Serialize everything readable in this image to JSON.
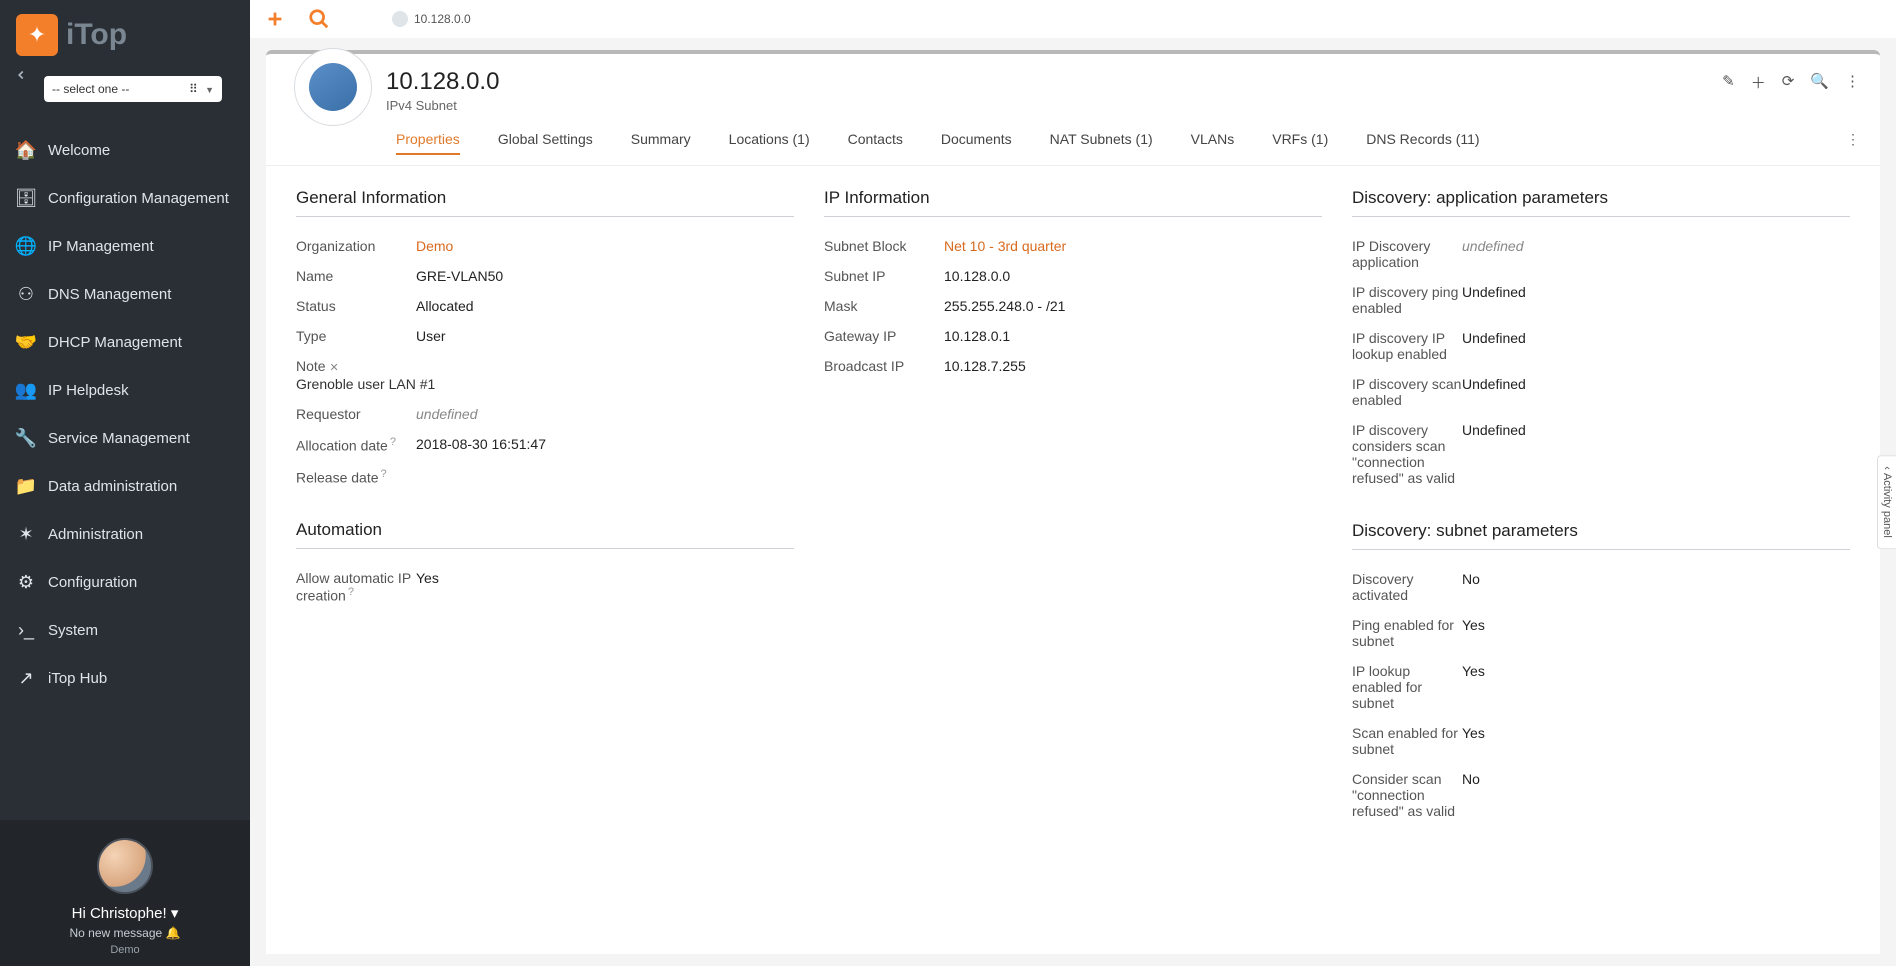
{
  "brand": "iTop",
  "org_select_placeholder": "-- select one --",
  "sidebar": {
    "items": [
      {
        "label": "Welcome"
      },
      {
        "label": "Configuration Management"
      },
      {
        "label": "IP Management"
      },
      {
        "label": "DNS Management"
      },
      {
        "label": "DHCP Management"
      },
      {
        "label": "IP Helpdesk"
      },
      {
        "label": "Service Management"
      },
      {
        "label": "Data administration"
      },
      {
        "label": "Administration"
      },
      {
        "label": "Configuration"
      },
      {
        "label": "System"
      },
      {
        "label": "iTop Hub"
      }
    ]
  },
  "user": {
    "greeting": "Hi Christophe!",
    "message": "No new message",
    "org": "Demo"
  },
  "tab_chip": "10.128.0.0",
  "object": {
    "title": "10.128.0.0",
    "subtitle": "IPv4 Subnet"
  },
  "tabs": [
    "Properties",
    "Global Settings",
    "Summary",
    "Locations (1)",
    "Contacts",
    "Documents",
    "NAT Subnets (1)",
    "VLANs",
    "VRFs (1)",
    "DNS Records (11)"
  ],
  "general": {
    "heading": "General Information",
    "organization_label": "Organization",
    "organization": "Demo",
    "name_label": "Name",
    "name": "GRE-VLAN50",
    "status_label": "Status",
    "status": "Allocated",
    "type_label": "Type",
    "type": "User",
    "note_label": "Note",
    "note": "Grenoble user LAN #1",
    "requestor_label": "Requestor",
    "requestor": "undefined",
    "alloc_label": "Allocation date",
    "alloc": "2018-08-30 16:51:47",
    "release_label": "Release date",
    "release": ""
  },
  "automation": {
    "heading": "Automation",
    "auto_ip_label": "Allow automatic IP creation",
    "auto_ip": "Yes"
  },
  "ip": {
    "heading": "IP Information",
    "block_label": "Subnet Block",
    "block": "Net 10 - 3rd quarter",
    "subnet_ip_label": "Subnet IP",
    "subnet_ip": "10.128.0.0",
    "mask_label": "Mask",
    "mask": "255.255.248.0 - /21",
    "gateway_label": "Gateway IP",
    "gateway": "10.128.0.1",
    "broadcast_label": "Broadcast IP",
    "broadcast": "10.128.7.255"
  },
  "disc_app": {
    "heading": "Discovery: application parameters",
    "app_label": "IP Discovery application",
    "app": "undefined",
    "ping_label": "IP discovery ping enabled",
    "ping": "Undefined",
    "lookup_label": "IP discovery IP lookup enabled",
    "lookup": "Undefined",
    "scan_label": "IP discovery scan enabled",
    "scan": "Undefined",
    "refused_label": "IP discovery considers scan \"connection refused\" as valid",
    "refused": "Undefined"
  },
  "disc_sub": {
    "heading": "Discovery: subnet parameters",
    "activated_label": "Discovery activated",
    "activated": "No",
    "ping_label": "Ping enabled for subnet",
    "ping": "Yes",
    "lookup_label": "IP lookup enabled for subnet",
    "lookup": "Yes",
    "scan_label": "Scan enabled for subnet",
    "scan": "Yes",
    "refused_label": "Consider scan \"connection refused\" as valid",
    "refused": "No"
  },
  "activity_panel": "Activity panel"
}
